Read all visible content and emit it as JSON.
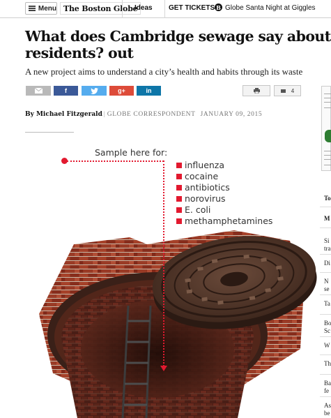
{
  "nav": {
    "menu_label": "Menu",
    "logo_text": "The Boston Globe",
    "ideas_label": "Ideas",
    "tickets_label": "GET TICKETS",
    "promo_icon_glyph": "B",
    "promo_text": "Globe Santa Night at Giggles"
  },
  "article": {
    "headline": "What does Cambridge sewage say about residents? out",
    "dek": "A new project aims to understand a city’s health and habits through its waste",
    "author": "By Michael Fitzgerald",
    "role": "GLOBE CORRESPONDENT",
    "date": "JANUARY 09, 2015"
  },
  "share": {
    "facebook": "f",
    "google_plus": "g+",
    "linkedin": "in",
    "comment_count": "4"
  },
  "graphic": {
    "title": "Sample here for:",
    "items": [
      "influenza",
      "cocaine",
      "antibiotics",
      "norovirus",
      "E. coli",
      "methamphetamines"
    ]
  },
  "rail": {
    "items": [
      "To",
      "M",
      "Si tra",
      "Di",
      "N se",
      "Ta",
      "Bo Sc",
      "W",
      "Th",
      "Ba fe",
      "As be"
    ]
  },
  "colors": {
    "accent_red": "#e2192f",
    "facebook": "#3b5998",
    "twitter": "#55acee",
    "google_plus": "#dd4b39",
    "linkedin": "#0e76a8"
  }
}
